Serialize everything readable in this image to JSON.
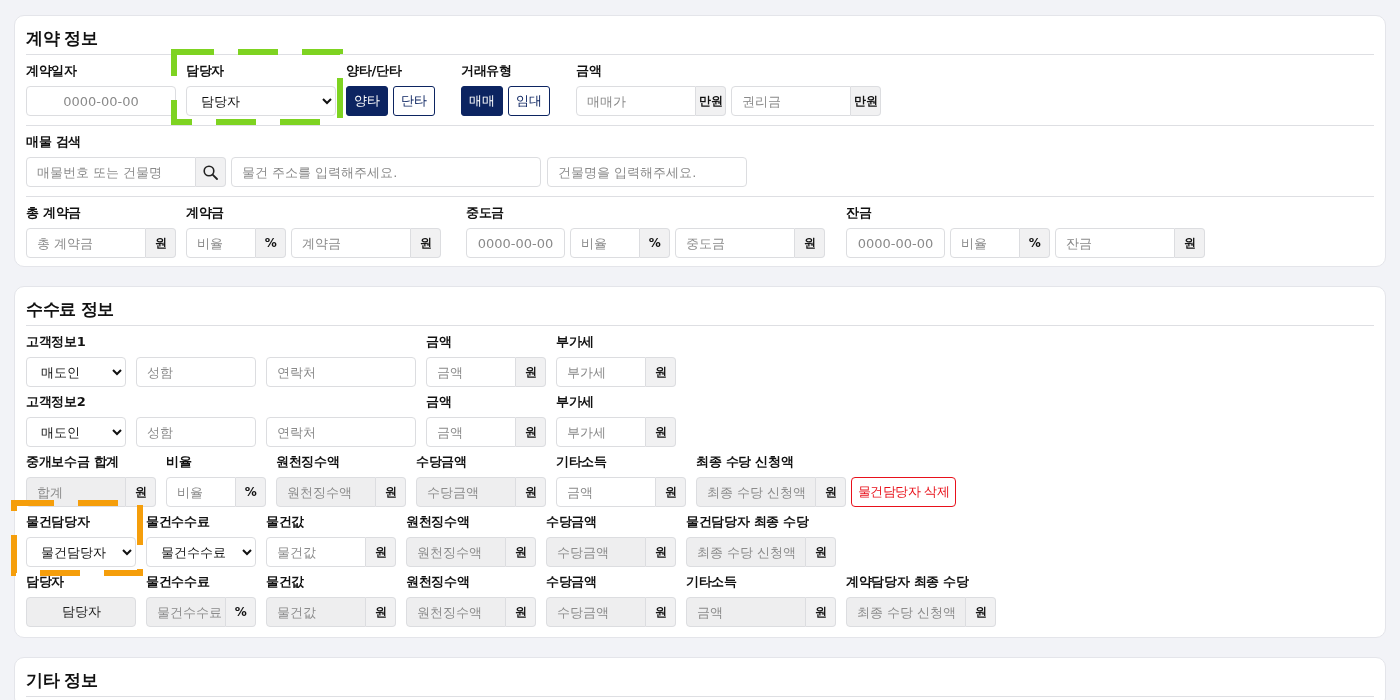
{
  "sections": [
    {
      "title": "계약 정보",
      "rows": [
        {
          "groups": [
            {
              "label": "계약일자",
              "controls": [
                {
                  "kind": "date",
                  "placeholder": "0000-00-00",
                  "disabled": false
                }
              ]
            },
            {
              "label": "담당자",
              "highlight": {
                "color": "#7ed321"
              },
              "controls": [
                {
                  "kind": "select",
                  "value": "담당자"
                }
              ]
            },
            {
              "label": "양타/단타",
              "controls": [
                {
                  "kind": "toggle",
                  "label": "양타",
                  "selected": true
                },
                {
                  "kind": "toggle",
                  "label": "단타",
                  "selected": false
                }
              ]
            },
            {
              "label": "거래유형",
              "controls": [
                {
                  "kind": "toggle",
                  "label": "매매",
                  "selected": true
                },
                {
                  "kind": "toggle",
                  "label": "임대",
                  "selected": false
                }
              ]
            },
            {
              "label": "금액",
              "controls": [
                {
                  "kind": "input",
                  "placeholder": "매매가",
                  "unit": "만원",
                  "disabled": false
                },
                {
                  "kind": "input",
                  "placeholder": "권리금",
                  "unit": "만원",
                  "disabled": false
                }
              ]
            }
          ]
        },
        {
          "groups": [
            {
              "label": "매물 검색",
              "controls": [
                {
                  "kind": "search",
                  "placeholder": "매물번호 또는 건물명"
                },
                {
                  "kind": "input",
                  "placeholder": "물건 주소를 입력해주세요.",
                  "disabled": false
                },
                {
                  "kind": "input",
                  "placeholder": "건물명을 입력해주세요.",
                  "disabled": false
                }
              ]
            }
          ]
        },
        {
          "groups": [
            {
              "label": "총 계약금",
              "controls": [
                {
                  "kind": "input",
                  "placeholder": "총 계약금",
                  "unit": "원",
                  "disabled": false
                }
              ]
            },
            {
              "label": "계약금",
              "controls": [
                {
                  "kind": "input",
                  "placeholder": "비율",
                  "unit": "%",
                  "disabled": false
                },
                {
                  "kind": "input",
                  "placeholder": "계약금",
                  "unit": "원",
                  "disabled": false
                }
              ]
            },
            {
              "label": "중도금",
              "controls": [
                {
                  "kind": "date",
                  "placeholder": "0000-00-00",
                  "disabled": false
                },
                {
                  "kind": "input",
                  "placeholder": "비율",
                  "unit": "%",
                  "disabled": false
                },
                {
                  "kind": "input",
                  "placeholder": "중도금",
                  "unit": "원",
                  "disabled": false
                }
              ]
            },
            {
              "label": "잔금",
              "controls": [
                {
                  "kind": "date",
                  "placeholder": "0000-00-00",
                  "disabled": false
                },
                {
                  "kind": "input",
                  "placeholder": "비율",
                  "unit": "%",
                  "disabled": false
                },
                {
                  "kind": "input",
                  "placeholder": "잔금",
                  "unit": "원",
                  "disabled": false
                }
              ]
            }
          ]
        }
      ]
    },
    {
      "title": "수수료 정보",
      "rows": [
        {
          "groups": [
            {
              "label": "고객정보1",
              "controls": [
                {
                  "kind": "select",
                  "value": "매도인"
                },
                {
                  "kind": "input",
                  "placeholder": "성함",
                  "disabled": false
                },
                {
                  "kind": "input",
                  "placeholder": "연락처",
                  "disabled": false
                }
              ]
            },
            {
              "label": "금액",
              "controls": [
                {
                  "kind": "input",
                  "placeholder": "금액",
                  "unit": "원",
                  "disabled": false
                }
              ]
            },
            {
              "label": "부가세",
              "controls": [
                {
                  "kind": "input",
                  "placeholder": "부가세",
                  "unit": "원",
                  "disabled": false
                }
              ]
            }
          ]
        },
        {
          "groups": [
            {
              "label": "고객정보2",
              "controls": [
                {
                  "kind": "select",
                  "value": "매도인"
                },
                {
                  "kind": "input",
                  "placeholder": "성함",
                  "disabled": false
                },
                {
                  "kind": "input",
                  "placeholder": "연락처",
                  "disabled": false
                }
              ]
            },
            {
              "label": "금액",
              "controls": [
                {
                  "kind": "input",
                  "placeholder": "금액",
                  "unit": "원",
                  "disabled": false
                }
              ]
            },
            {
              "label": "부가세",
              "controls": [
                {
                  "kind": "input",
                  "placeholder": "부가세",
                  "unit": "원",
                  "disabled": false
                }
              ]
            }
          ]
        },
        {
          "groups": [
            {
              "label": "중개보수금 합계",
              "controls": [
                {
                  "kind": "input",
                  "placeholder": "합계",
                  "unit": "원",
                  "disabled": true
                }
              ]
            },
            {
              "label": "비율",
              "controls": [
                {
                  "kind": "input",
                  "placeholder": "비율",
                  "unit": "%",
                  "disabled": false
                }
              ]
            },
            {
              "label": "원천징수액",
              "controls": [
                {
                  "kind": "input",
                  "placeholder": "원천징수액",
                  "unit": "원",
                  "disabled": true
                }
              ]
            },
            {
              "label": "수당금액",
              "controls": [
                {
                  "kind": "input",
                  "placeholder": "수당금액",
                  "unit": "원",
                  "disabled": true
                }
              ]
            },
            {
              "label": "기타소득",
              "controls": [
                {
                  "kind": "input",
                  "placeholder": "금액",
                  "unit": "원",
                  "disabled": false
                }
              ]
            },
            {
              "label": "최종 수당 신청액",
              "controls": [
                {
                  "kind": "input",
                  "placeholder": "최종 수당 신청액",
                  "unit": "원",
                  "disabled": true
                },
                {
                  "kind": "danger",
                  "label": "물건담당자 삭제"
                }
              ]
            }
          ]
        },
        {
          "groups": [
            {
              "label": "물건담당자",
              "highlight": {
                "color": "#f59e0b"
              },
              "controls": [
                {
                  "kind": "select",
                  "value": "물건담당자"
                }
              ]
            },
            {
              "label": "물건수수료",
              "controls": [
                {
                  "kind": "select",
                  "value": "물건수수료"
                }
              ]
            },
            {
              "label": "물건값",
              "controls": [
                {
                  "kind": "input",
                  "placeholder": "물건값",
                  "unit": "원",
                  "disabled": false
                }
              ]
            },
            {
              "label": "원천징수액",
              "controls": [
                {
                  "kind": "input",
                  "placeholder": "원천징수액",
                  "unit": "원",
                  "disabled": true
                }
              ]
            },
            {
              "label": "수당금액",
              "controls": [
                {
                  "kind": "input",
                  "placeholder": "수당금액",
                  "unit": "원",
                  "disabled": true
                }
              ]
            },
            {
              "label": "물건담당자 최종 수당",
              "controls": [
                {
                  "kind": "input",
                  "placeholder": "최종 수당 신청액",
                  "unit": "원",
                  "disabled": true
                }
              ]
            }
          ]
        },
        {
          "groups": [
            {
              "label": "담당자",
              "controls": [
                {
                  "kind": "display",
                  "value": "담당자",
                  "disabled": true
                }
              ]
            },
            {
              "label": "물건수수료",
              "controls": [
                {
                  "kind": "input",
                  "placeholder": "물건수수료",
                  "unit": "%",
                  "disabled": true
                }
              ]
            },
            {
              "label": "물건값",
              "controls": [
                {
                  "kind": "input",
                  "placeholder": "물건값",
                  "unit": "원",
                  "disabled": true
                }
              ]
            },
            {
              "label": "원천징수액",
              "controls": [
                {
                  "kind": "input",
                  "placeholder": "원천징수액",
                  "unit": "원",
                  "disabled": true
                }
              ]
            },
            {
              "label": "수당금액",
              "controls": [
                {
                  "kind": "input",
                  "placeholder": "수당금액",
                  "unit": "원",
                  "disabled": true
                }
              ]
            },
            {
              "label": "기타소득",
              "controls": [
                {
                  "kind": "input",
                  "placeholder": "금액",
                  "unit": "원",
                  "disabled": true
                }
              ]
            },
            {
              "label": "계약담당자 최종 수당",
              "controls": [
                {
                  "kind": "input",
                  "placeholder": "최종 수당 신청액",
                  "unit": "원",
                  "disabled": true
                }
              ]
            }
          ]
        }
      ]
    },
    {
      "title": "기타 정보"
    }
  ]
}
